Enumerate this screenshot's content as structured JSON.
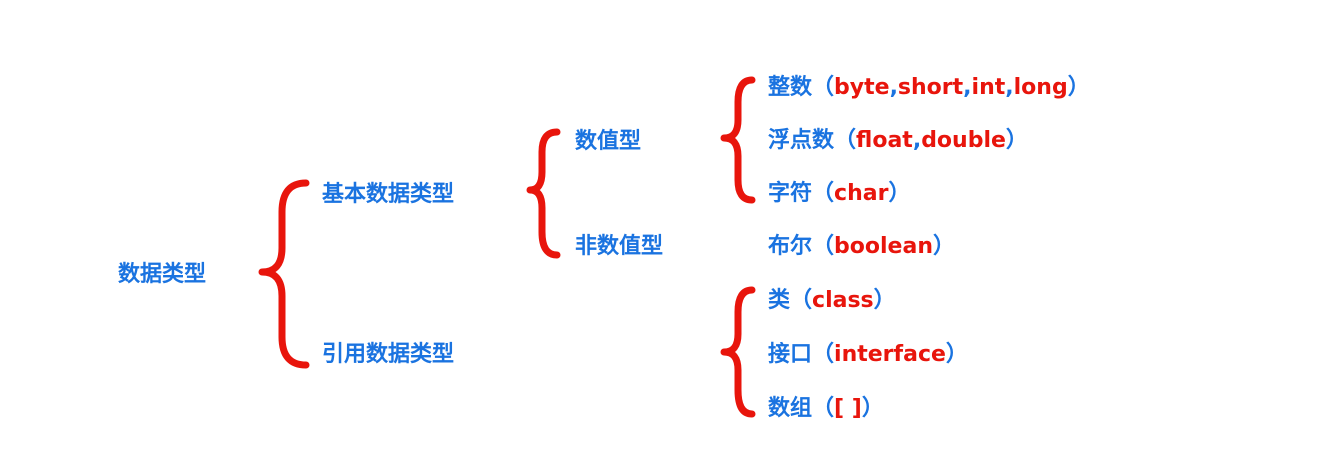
{
  "root": "数据类型",
  "level1": {
    "primitive": "基本数据类型",
    "reference": "引用数据类型"
  },
  "level2": {
    "numeric": "数值型",
    "non_numeric": "非数值型"
  },
  "numeric_types": [
    {
      "name": "整数",
      "open": "（",
      "parts": [
        "byte",
        ",",
        "short",
        ",",
        "int",
        ",",
        "long"
      ],
      "close": "）"
    },
    {
      "name": "浮点数",
      "open": "（",
      "parts": [
        "float",
        ",",
        "double"
      ],
      "close": "）"
    },
    {
      "name": "字符",
      "open": "（",
      "parts": [
        "char"
      ],
      "close": "）"
    }
  ],
  "non_numeric_types": [
    {
      "name": "布尔",
      "open": "（",
      "parts": [
        "boolean"
      ],
      "close": "）"
    }
  ],
  "reference_types": [
    {
      "name": "类",
      "open": "（",
      "parts": [
        "class"
      ],
      "close": "）"
    },
    {
      "name": "接口",
      "open": "（",
      "parts": [
        "interface"
      ],
      "close": "）"
    },
    {
      "name": "数组",
      "open": "（",
      "parts": [
        "[ ]"
      ],
      "close": "）"
    }
  ],
  "colors": {
    "label": "#1a73e0",
    "keyword": "#e8150c",
    "brace": "#e8150c"
  }
}
